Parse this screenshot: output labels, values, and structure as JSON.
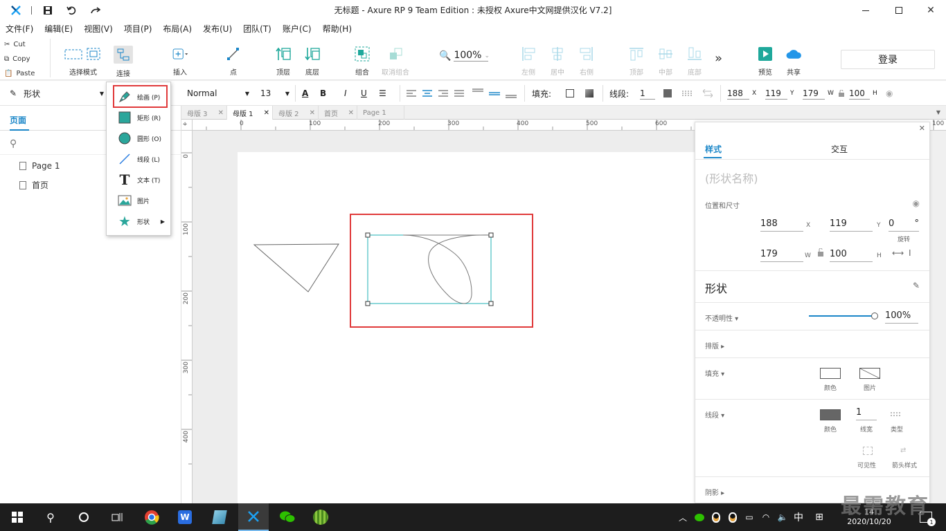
{
  "titlebar": {
    "title": "无标题 - Axure RP 9 Team Edition : 未授权    Axure中文网提供汉化 V7.2]"
  },
  "menu": [
    "文件(F)",
    "编辑(E)",
    "视图(V)",
    "项目(P)",
    "布局(A)",
    "发布(U)",
    "团队(T)",
    "账户(C)",
    "帮助(H)"
  ],
  "clipboard": {
    "cut": "Cut",
    "copy": "Copy",
    "paste": "Paste"
  },
  "toolbar": {
    "select_mode": "选择模式",
    "connect": "连接",
    "insert": "插入",
    "point": "点",
    "front": "顶层",
    "back": "底层",
    "group": "组合",
    "ungroup": "取消组合",
    "zoom": "100%",
    "align_left": "左侧",
    "align_center": "居中",
    "align_right": "右侧",
    "align_top": "顶部",
    "align_middle": "中部",
    "align_bottom": "底部",
    "preview": "预览",
    "share": "共享",
    "login": "登录"
  },
  "format": {
    "shape_type": "形状",
    "font_style": "Normal",
    "font_size": "13",
    "fill_label": "填充:",
    "stroke_label": "线段:",
    "stroke_width": "1",
    "x": "188",
    "x_l": "X",
    "y": "119",
    "y_l": "Y",
    "w": "179",
    "w_l": "W",
    "h": "100",
    "h_l": "H"
  },
  "left": {
    "tab": "页面",
    "pages": [
      "Page 1",
      "首页"
    ]
  },
  "tabs": [
    "母版 3",
    "母版 1",
    "母版 2",
    "首页",
    "Page 1"
  ],
  "ruler": {
    "h": [
      "0",
      "100",
      "200",
      "300",
      "400",
      "500",
      "600",
      "100"
    ],
    "v": [
      "0",
      "100",
      "200",
      "300",
      "400"
    ]
  },
  "dropdown": {
    "items": [
      "绘画 (P)",
      "矩形 (R)",
      "圆形 (O)",
      "线段 (L)",
      "文本 (T)",
      "图片",
      "形状"
    ]
  },
  "right": {
    "tab_style": "样式",
    "tab_interact": "交互",
    "shape_name": "(形状名称)",
    "pos_label": "位置和尺寸",
    "x": "188",
    "x_l": "X",
    "y": "119",
    "y_l": "Y",
    "rot": "0",
    "rot_unit": "°",
    "rot_l": "旋转",
    "w": "179",
    "w_l": "W",
    "h": "100",
    "h_l": "H",
    "shape_title": "形状",
    "opacity_label": "不透明性",
    "opacity": "100%",
    "layout_label": "排版",
    "fill_label": "填充",
    "fill_color": "颜色",
    "fill_image": "图片",
    "stroke_label": "线段",
    "stroke_color": "颜色",
    "stroke_width": "1",
    "stroke_width_l": "线宽",
    "stroke_type": "类型",
    "visibility": "可见性",
    "arrow_style": "箭头样式",
    "shadow_label": "阴影"
  },
  "taskbar": {
    "ime": "中",
    "time": "2020/10/20",
    "time_top": "14",
    "notif": "1"
  },
  "watermark": "最需教育"
}
